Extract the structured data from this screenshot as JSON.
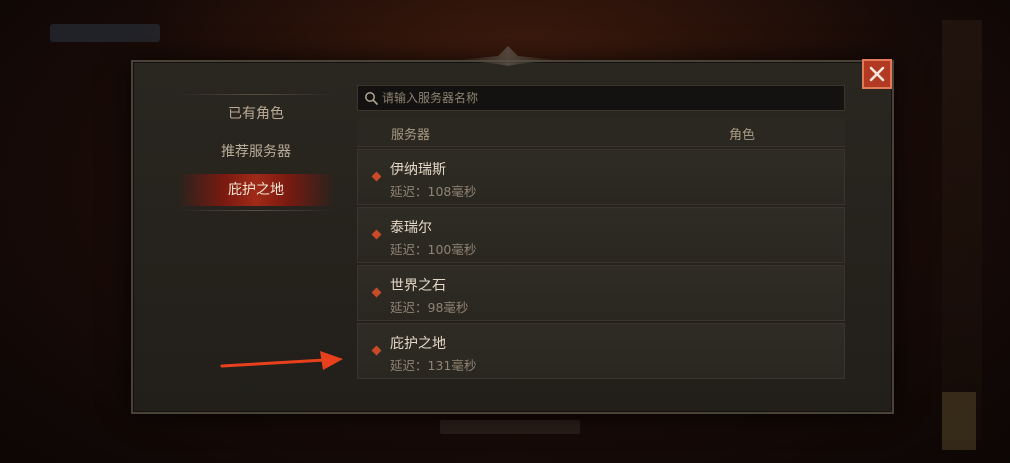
{
  "search": {
    "placeholder": "请输入服务器名称"
  },
  "tabs": [
    {
      "label": "已有角色"
    },
    {
      "label": "推荐服务器"
    },
    {
      "label": "庇护之地"
    }
  ],
  "table": {
    "headers": [
      "服务器",
      "角色"
    ]
  },
  "servers": [
    {
      "name": "伊纳瑞斯",
      "latency": "延迟：108毫秒"
    },
    {
      "name": "泰瑞尔",
      "latency": "延迟：100毫秒"
    },
    {
      "name": "世界之石",
      "latency": "延迟：98毫秒"
    },
    {
      "name": "庇护之地",
      "latency": "延迟：131毫秒"
    }
  ],
  "colors": {
    "accent": "#c94a26",
    "close": "#b23a22",
    "selected_tab": "#a02a18",
    "arrow": "#e8401c"
  },
  "icons": {
    "search": "search-icon",
    "close": "close-icon",
    "marker": "diamond-icon",
    "arrow": "arrow-right-icon"
  }
}
